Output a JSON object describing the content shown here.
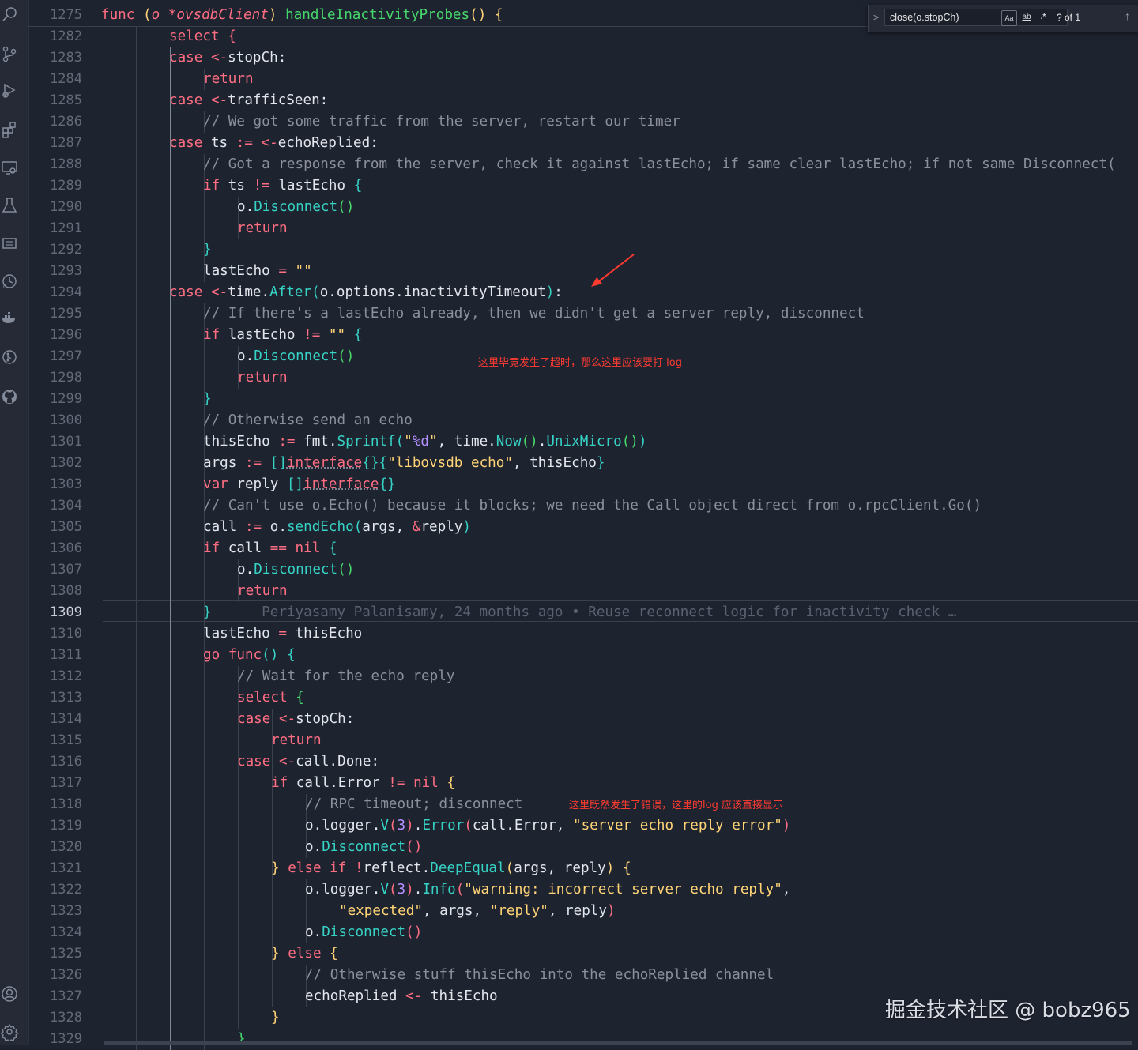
{
  "activity_bar": {
    "icons": [
      "search-icon",
      "source-control-icon",
      "run-debug-icon",
      "extensions-icon",
      "remote-explorer-icon",
      "testing-icon",
      "outline-icon",
      "timeline-icon",
      "docker-icon",
      "git-history-icon",
      "github-icon",
      "account-icon",
      "settings-icon"
    ]
  },
  "find_widget": {
    "query": "close(o.stopCh)",
    "case_label": "Aa",
    "word_label": "ab",
    "regex_label": ".*",
    "count": "? of 1",
    "prev_icon": "↑"
  },
  "line_numbers": [
    "1275",
    "1282",
    "1283",
    "1284",
    "1285",
    "1286",
    "1287",
    "1288",
    "1289",
    "1290",
    "1291",
    "1292",
    "1293",
    "1294",
    "1295",
    "1296",
    "1297",
    "1298",
    "1299",
    "1300",
    "1301",
    "1302",
    "1303",
    "1304",
    "1305",
    "1306",
    "1307",
    "1308",
    "1309",
    "1310",
    "1311",
    "1312",
    "1313",
    "1314",
    "1315",
    "1316",
    "1317",
    "1318",
    "1319",
    "1320",
    "1321",
    "1322",
    "1323",
    "1324",
    "1325",
    "1326",
    "1327",
    "1328",
    "1329"
  ],
  "active_line": "1309",
  "code": [
    "func (o *ovsdbClient) handleInactivityProbes() {",
    "select {",
    "case <-stopCh:",
    "return",
    "case <-trafficSeen:",
    "// We got some traffic from the server, restart our timer",
    "case ts := <-echoReplied:",
    "// Got a response from the server, check it against lastEcho; if same clear lastEcho; if not same Disconnect(",
    "if ts != lastEcho {",
    "o.Disconnect()",
    "return",
    "}",
    "lastEcho = \"\"",
    "case <-time.After(o.options.inactivityTimeout):",
    "// If there's a lastEcho already, then we didn't get a server reply, disconnect",
    "if lastEcho != \"\" {",
    "o.Disconnect()",
    "return",
    "}",
    "// Otherwise send an echo",
    "thisEcho := fmt.Sprintf(\"%d\", time.Now().UnixMicro())",
    "args := []interface{}{\"libovsdb echo\", thisEcho}",
    "var reply []interface{}",
    "// Can't use o.Echo() because it blocks; we need the Call object direct from o.rpcClient.Go()",
    "call := o.sendEcho(args, &reply)",
    "if call == nil {",
    "o.Disconnect()",
    "return",
    "}",
    "lastEcho = thisEcho",
    "go func() {",
    "// Wait for the echo reply",
    "select {",
    "case <-stopCh:",
    "return",
    "case <-call.Done:",
    "if call.Error != nil {",
    "// RPC timeout; disconnect",
    "o.logger.V(3).Error(call.Error, \"server echo reply error\")",
    "o.Disconnect()",
    "} else if !reflect.DeepEqual(args, reply) {",
    "o.logger.V(3).Info(\"warning: incorrect server echo reply\",",
    "\"expected\", args, \"reply\", reply)",
    "o.Disconnect()",
    "} else {",
    "// Otherwise stuff thisEcho into the echoReplied channel",
    "echoReplied <- thisEcho",
    "}",
    "}"
  ],
  "blame": "Periyasamy Palanisamy, 24 months ago • Reuse reconnect logic for inactivity check …",
  "annotations": {
    "timeout_note": "这里毕竟发生了超时，那么这里应该要打 log",
    "error_note": "这里既然发生了错误，这里的log 应该直接显示"
  },
  "watermark": "掘金技术社区 @ bobz965",
  "colors": {
    "background": "#1e2330",
    "keyword": "#ff6e82",
    "function": "#36d2c4",
    "string": "#ffd476",
    "comment": "#8b909c",
    "number": "#b591ff",
    "annotation": "#ff3b30"
  }
}
